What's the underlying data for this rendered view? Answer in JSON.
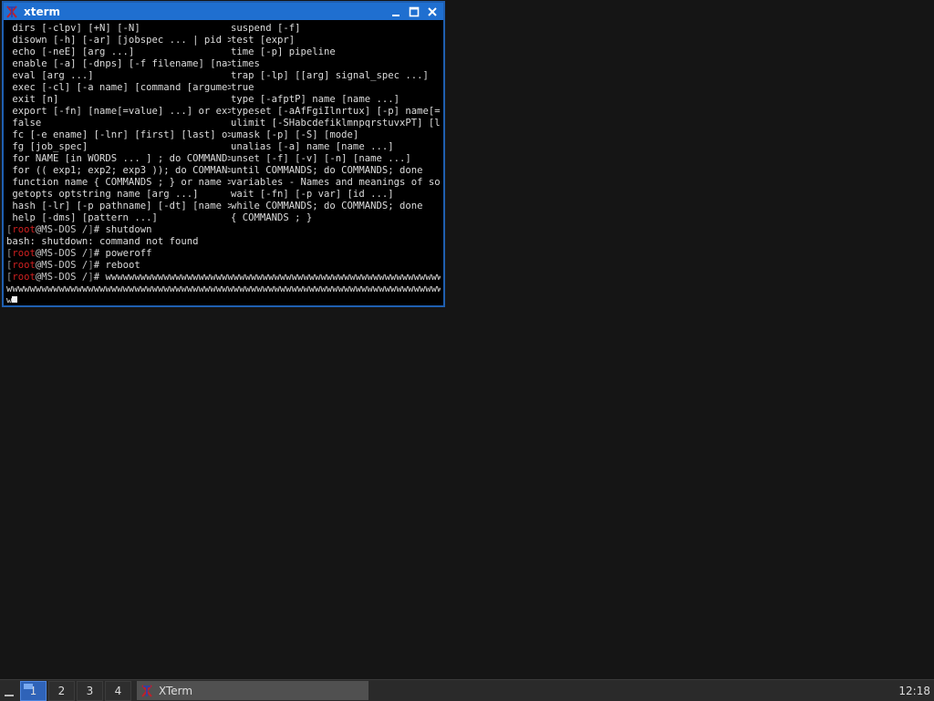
{
  "window": {
    "title": "xterm",
    "icon": "xterm-logo-icon",
    "controls": [
      "minimize-icon",
      "maximize-icon",
      "close-icon"
    ]
  },
  "terminal": {
    "help_rows": [
      [
        "dirs [-clpv] [+N] [-N]",
        "suspend [-f]"
      ],
      [
        "disown [-h] [-ar] [jobspec ... | pid >",
        "test [expr]"
      ],
      [
        "echo [-neE] [arg ...]",
        "time [-p] pipeline"
      ],
      [
        "enable [-a] [-dnps] [-f filename] [na>",
        "times"
      ],
      [
        "eval [arg ...]",
        "trap [-lp] [[arg] signal_spec ...]"
      ],
      [
        "exec [-cl] [-a name] [command [argume>",
        "true"
      ],
      [
        "exit [n]",
        "type [-afptP] name [name ...]"
      ],
      [
        "export [-fn] [name[=value] ...] or ex>",
        "typeset [-aAfFgiIlnrtux] [-p] name[=>"
      ],
      [
        "false",
        "ulimit [-SHabcdefiklmnpqrstuvxPT] [l>"
      ],
      [
        "fc [-e ename] [-lnr] [first] [last] o>",
        "umask [-p] [-S] [mode]"
      ],
      [
        "fg [job_spec]",
        "unalias [-a] name [name ...]"
      ],
      [
        "for NAME [in WORDS ... ] ; do COMMAND>",
        "unset [-f] [-v] [-n] [name ...]"
      ],
      [
        "for (( exp1; exp2; exp3 )); do COMMAN>",
        "until COMMANDS; do COMMANDS; done"
      ],
      [
        "function name { COMMANDS ; } or name >",
        "variables - Names and meanings of so>"
      ],
      [
        "getopts optstring name [arg ...]",
        "wait [-fn] [-p var] [id ...]"
      ],
      [
        "hash [-lr] [-p pathname] [-dt] [name >",
        "while COMMANDS; do COMMANDS; done"
      ],
      [
        "help [-dms] [pattern ...]",
        "{ COMMANDS ; }"
      ]
    ],
    "prompt": {
      "open": "[",
      "user": "root",
      "host": "@MS-DOS /",
      "close": "]",
      "symbol": "# "
    },
    "session": [
      {
        "type": "prompt",
        "command": "shutdown"
      },
      {
        "type": "output",
        "text": "bash: shutdown: command not found"
      },
      {
        "type": "prompt",
        "command": "poweroff"
      },
      {
        "type": "prompt",
        "command": "reboot"
      },
      {
        "type": "prompt",
        "command": "wwwwwwwwwwwwwwwwwwwwwwwwwwwwwwwwwwwwwwwwwwwwwwwwwwwwwwwwwwwwwwwwwwwwwwwwwww"
      },
      {
        "type": "output",
        "text": "wwwwwwwwwwwwwwwwwwwwwwwwwwwwwwwwwwwwwwwwwwwwwwwwwwwwwwwwwwwwwwwwwwwwwwwwwwwwwwwwwwwwwwwwwwwwwwwwwww"
      },
      {
        "type": "input",
        "text": "w"
      }
    ]
  },
  "taskbar": {
    "show_desktop_icon": "show-desktop-icon",
    "workspaces": [
      "1",
      "2",
      "3",
      "4"
    ],
    "active_workspace": "1",
    "tasks": [
      {
        "label": "XTerm",
        "icon": "xterm-logo-icon"
      }
    ],
    "clock": "12:18"
  }
}
